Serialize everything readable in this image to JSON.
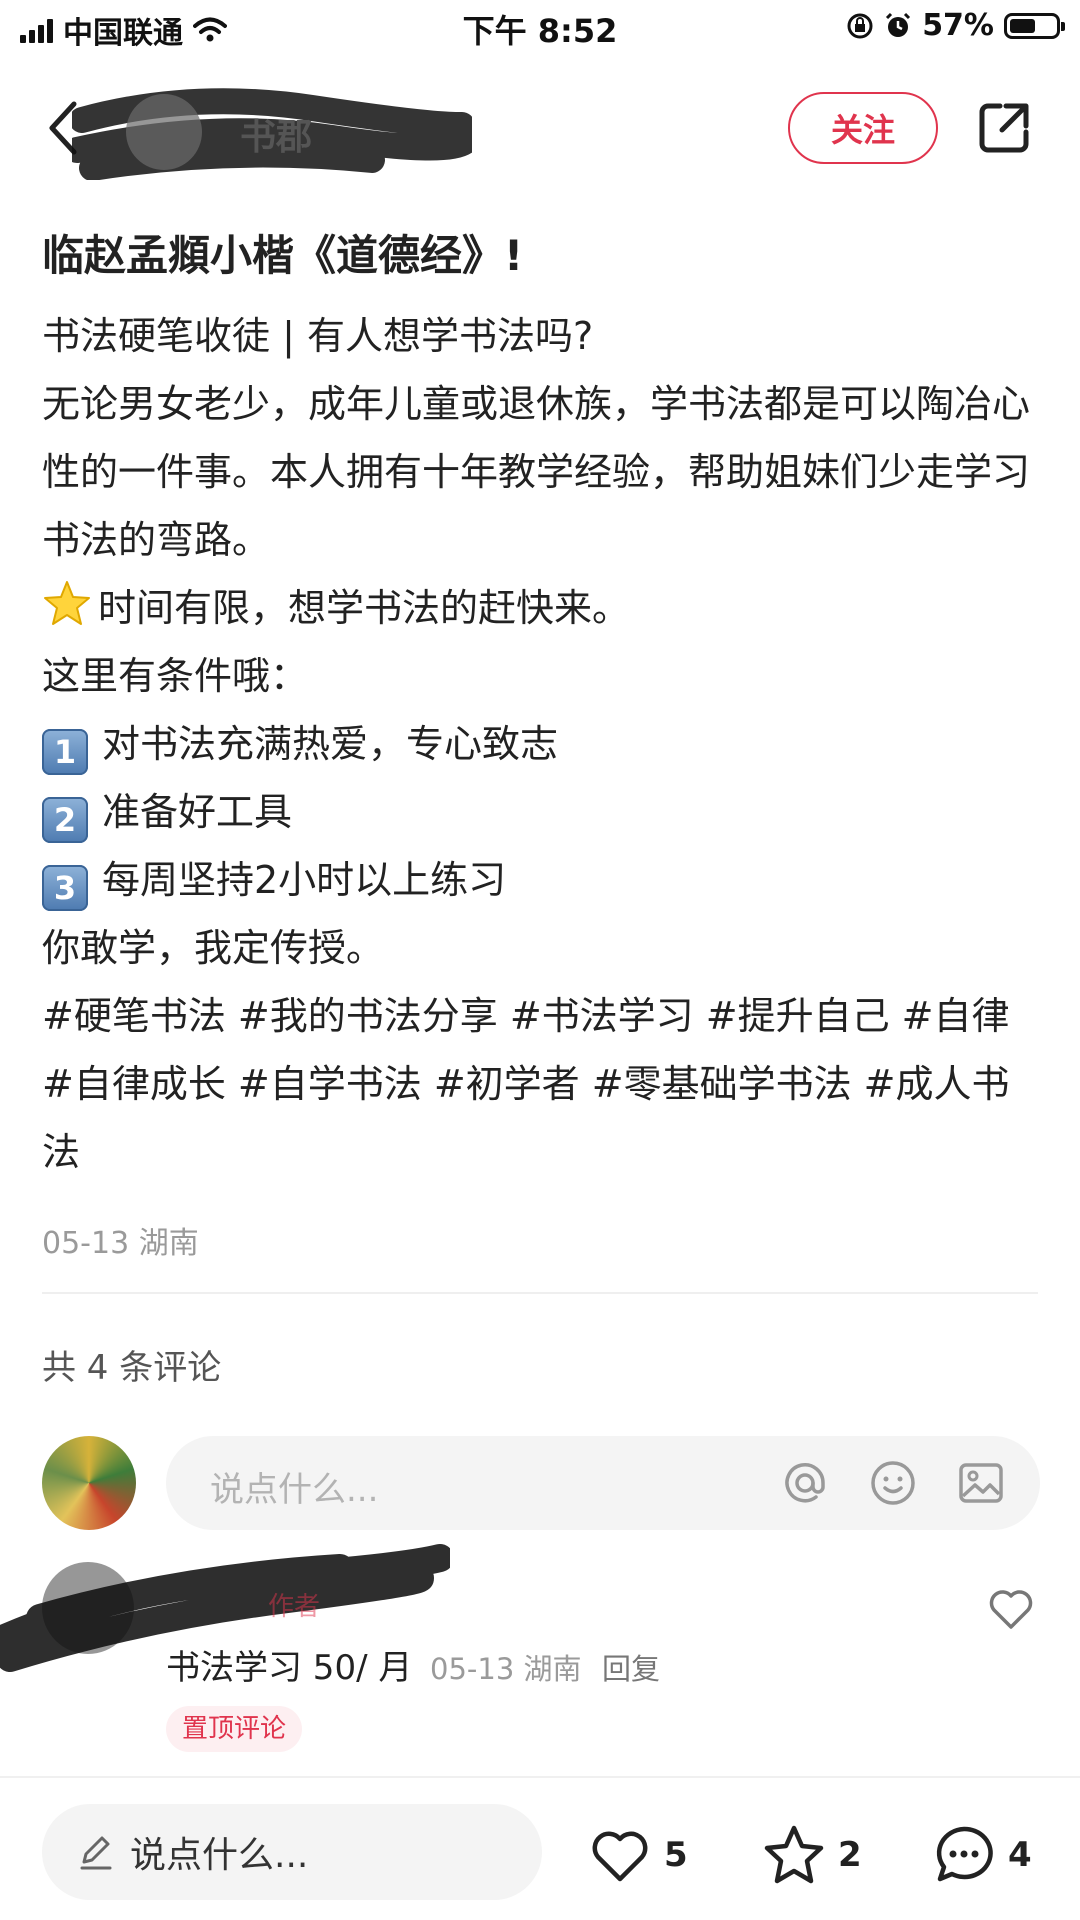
{
  "status_bar": {
    "carrier": "中国联通",
    "time": "下午 8:52",
    "battery": "57%",
    "battery_fraction": 0.57
  },
  "header": {
    "author_name": "书郡",
    "follow_label": "关注"
  },
  "post": {
    "title": "临赵孟頫小楷《道德经》!",
    "line1": "书法硬笔收徒 | 有人想学书法吗?",
    "paragraph": "无论男女老少，成年儿童或退休族，学书法都是可以陶冶心性的一件事。本人拥有十年教学经验，帮助姐妹们少走学习书法的弯路。",
    "star_line": "时间有限，想学书法的赶快来。",
    "conditions_intro": "这里有条件哦：",
    "conditions": [
      {
        "key": "1",
        "text": "对书法充满热爱，专心致志"
      },
      {
        "key": "2",
        "text": "准备好工具"
      },
      {
        "key": "3",
        "text": "每周坚持2小时以上练习"
      }
    ],
    "closing": "你敢学，我定传授。",
    "hashtags": "#硬笔书法 #我的书法分享 #书法学习 #提升自己 #自律 #自律成长 #自学书法 #初学者 #零基础学书法 #成人书法",
    "meta": "05-13 湖南"
  },
  "comments": {
    "count_label": "共 4 条评论",
    "input_placeholder": "说点什么...",
    "items": [
      {
        "tag": "作者",
        "text": "书法学习 50/ 月",
        "meta": "05-13 湖南",
        "reply_label": "回复",
        "pinned_label": "置顶评论"
      }
    ]
  },
  "bottom_bar": {
    "input_placeholder": "说点什么...",
    "likes": "5",
    "favorites": "2",
    "comments": "4"
  },
  "colors": {
    "accent": "#e0344d",
    "muted": "#9a9a9a"
  }
}
